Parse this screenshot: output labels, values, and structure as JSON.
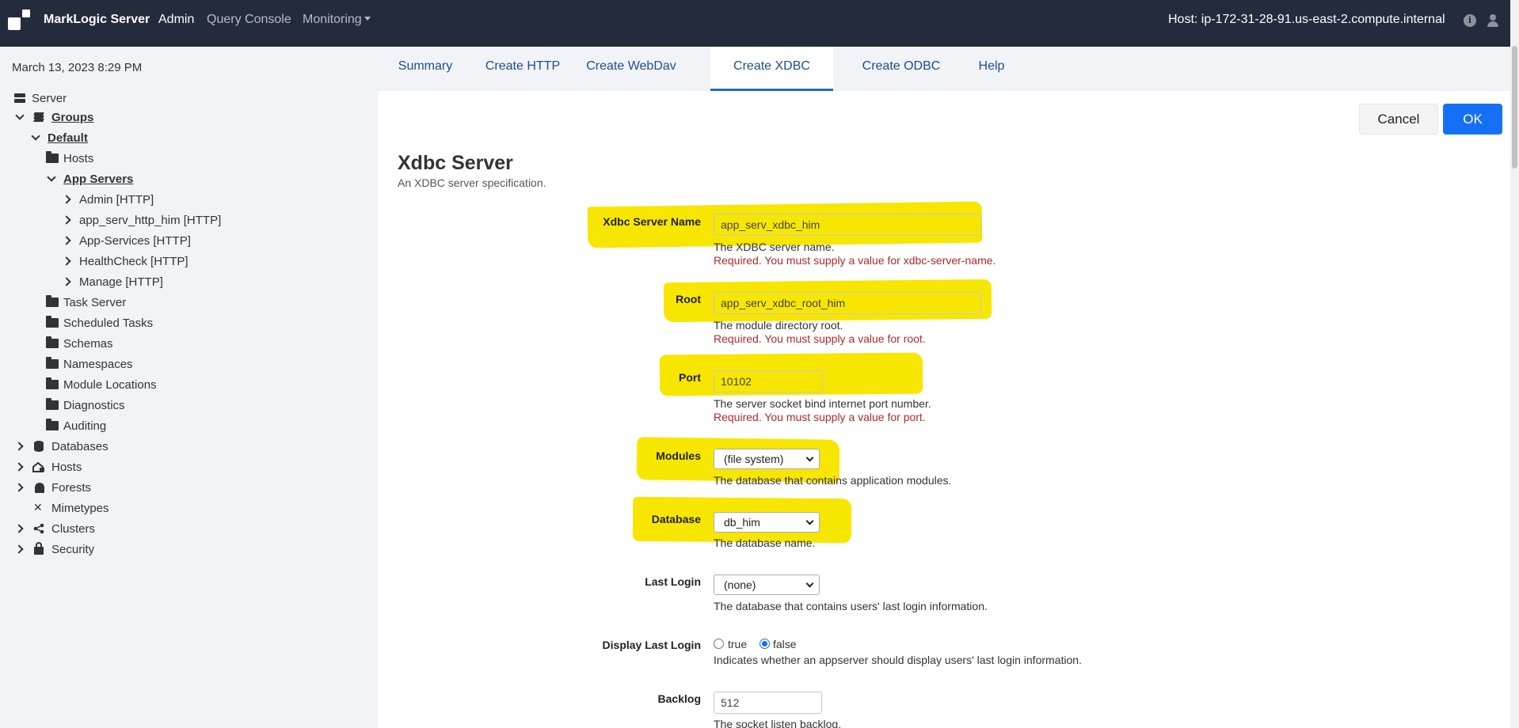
{
  "topbar": {
    "brand": "MarkLogic Server",
    "nav": {
      "admin": "Admin",
      "query_console": "Query Console",
      "monitoring": "Monitoring"
    },
    "host": "Host: ip-172-31-28-91.us-east-2.compute.internal",
    "info_icon_glyph": "i"
  },
  "sidebar": {
    "date": "March 13, 2023 8:29 PM",
    "tree": {
      "server": "Server",
      "groups": "Groups",
      "default": "Default",
      "hosts_folder": "Hosts",
      "app_servers": "App Servers",
      "app_admin": "Admin [HTTP]",
      "app_him": "app_serv_http_him [HTTP]",
      "app_services": "App-Services [HTTP]",
      "app_healthcheck": "HealthCheck [HTTP]",
      "app_manage": "Manage [HTTP]",
      "task_server": "Task Server",
      "scheduled_tasks": "Scheduled Tasks",
      "schemas": "Schemas",
      "namespaces": "Namespaces",
      "module_locations": "Module Locations",
      "diagnostics": "Diagnostics",
      "auditing": "Auditing",
      "databases": "Databases",
      "hosts": "Hosts",
      "forests": "Forests",
      "mimetypes": "Mimetypes",
      "clusters": "Clusters",
      "security": "Security",
      "mimetypes_icon_glyph": "✕"
    }
  },
  "tabs": {
    "summary": "Summary",
    "create_http": "Create HTTP",
    "create_webdav": "Create WebDav",
    "create_xdbc": "Create XDBC",
    "create_odbc": "Create ODBC",
    "help": "Help",
    "active": "Create XDBC"
  },
  "actions": {
    "cancel": "Cancel",
    "ok": "OK"
  },
  "form": {
    "title": "Xdbc Server",
    "subtitle": "An XDBC server specification.",
    "server_name": {
      "label": "Xdbc Server Name",
      "value": "app_serv_xdbc_him",
      "help": "The XDBC server name.",
      "error": "Required. You must supply a value for xdbc-server-name."
    },
    "root": {
      "label": "Root",
      "value": "app_serv_xdbc_root_him",
      "help": "The module directory root.",
      "error": "Required. You must supply a value for root."
    },
    "port": {
      "label": "Port",
      "value": "10102",
      "help": "The server socket bind internet port number.",
      "error": "Required. You must supply a value for port."
    },
    "modules": {
      "label": "Modules",
      "value": "(file system)",
      "help": "The database that contains application modules."
    },
    "database": {
      "label": "Database",
      "value": "db_him",
      "help": "The database name."
    },
    "last_login": {
      "label": "Last Login",
      "value": "(none)",
      "help": "The database that contains users' last login information."
    },
    "display_last_login": {
      "label": "Display Last Login",
      "true_label": "true",
      "false_label": "false",
      "selected": "false",
      "help": "Indicates whether an appserver should display users' last login information."
    },
    "backlog": {
      "label": "Backlog",
      "value": "512",
      "help": "The socket listen backlog."
    }
  },
  "colors": {
    "topbar": "#242b3d",
    "sidebar": "#f1f3f6",
    "highlight": "#f7e600",
    "primary": "#1670f5",
    "error": "#b02a2a",
    "tab_text": "#1f4e8d"
  }
}
